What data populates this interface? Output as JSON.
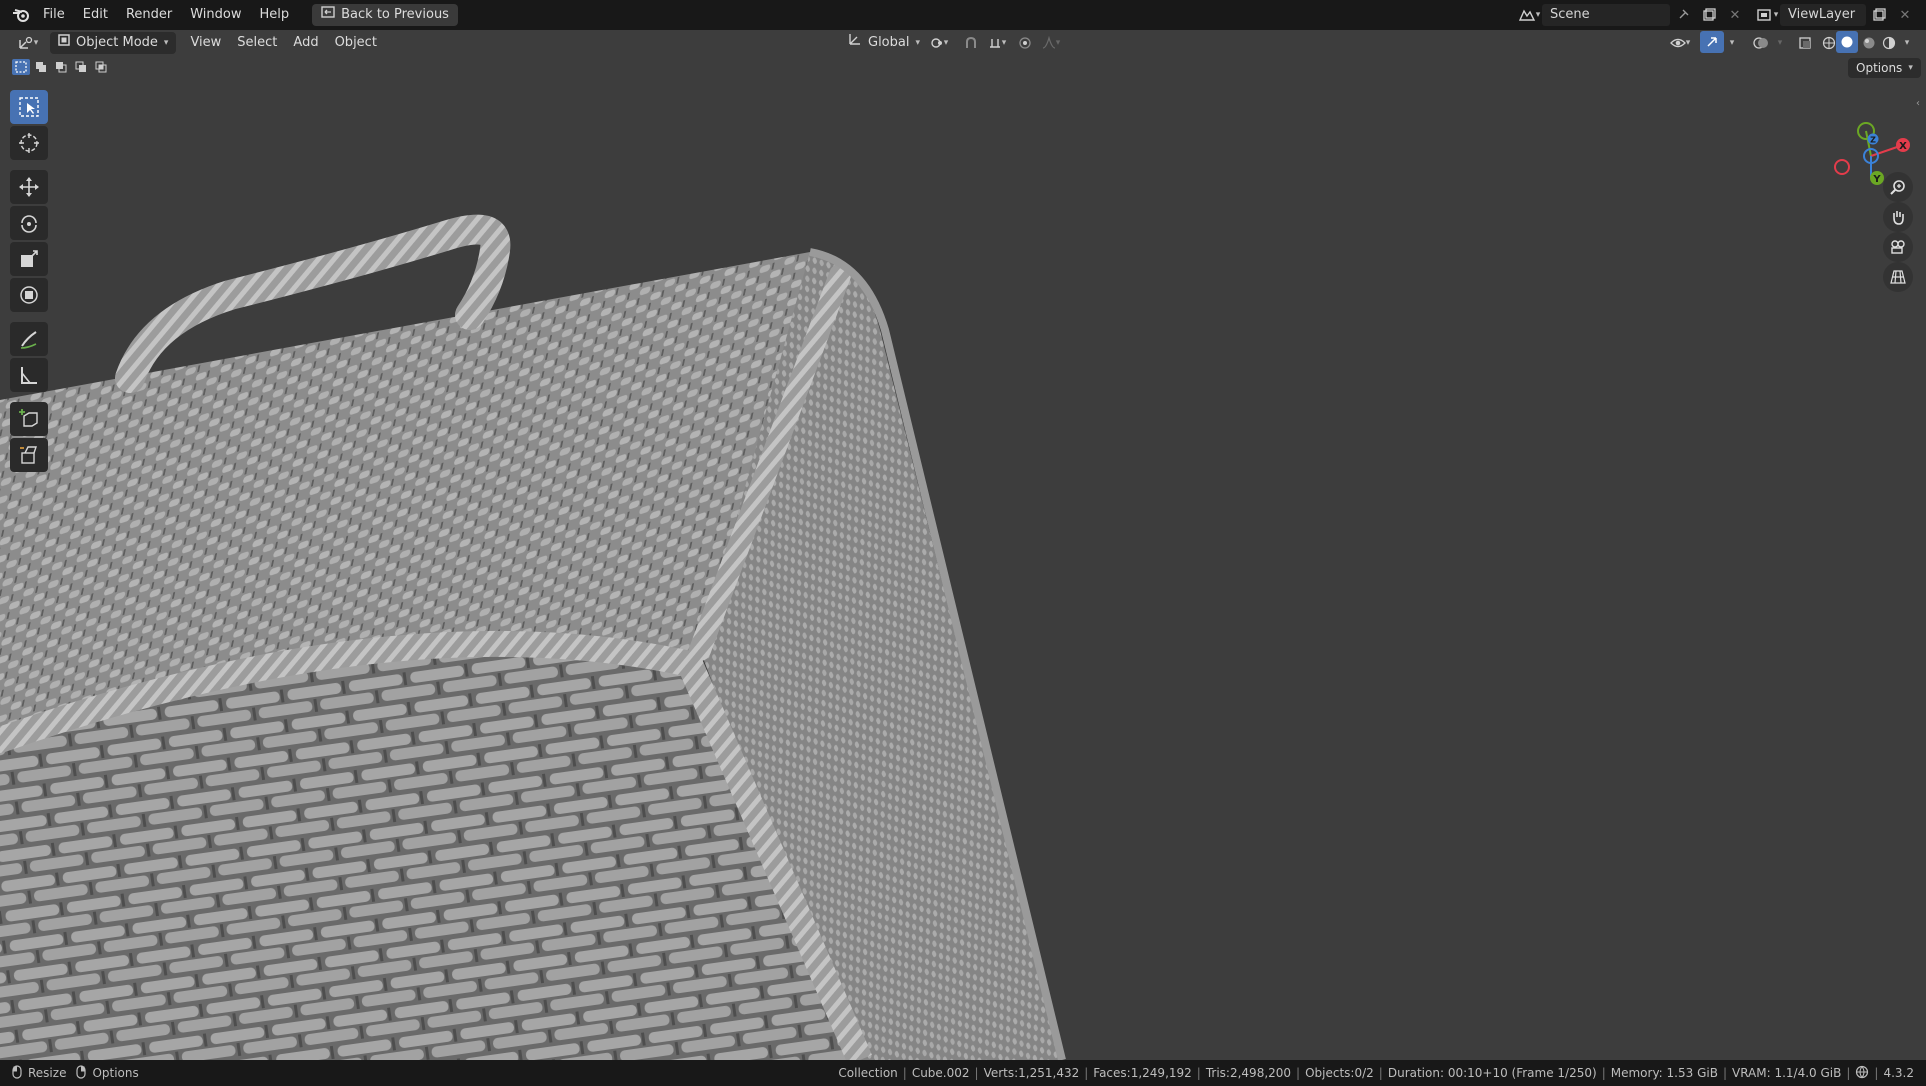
{
  "menu": {
    "file": "File",
    "edit": "Edit",
    "render": "Render",
    "window": "Window",
    "help": "Help",
    "back_label": "Back to Previous"
  },
  "scene": {
    "scene_name": "Scene",
    "view_layer": "ViewLayer"
  },
  "header": {
    "mode": "Object Mode",
    "view": "View",
    "select": "Select",
    "add": "Add",
    "object": "Object",
    "orientation": "Global",
    "options": "Options"
  },
  "gizmo": {
    "x": "X",
    "y": "Y",
    "z": "Z"
  },
  "status": {
    "left_resize": "Resize",
    "left_options": "Options",
    "collection": "Collection",
    "object": "Cube.002",
    "verts": "Verts:1,251,432",
    "faces": "Faces:1,249,192",
    "tris": "Tris:2,498,200",
    "objects": "Objects:0/2",
    "duration": "Duration: 00:10+10 (Frame 1/250)",
    "memory": "Memory: 1.53 GiB",
    "vram": "VRAM: 1.1/4.0 GiB",
    "version": "4.3.2"
  },
  "colors": {
    "accent": "#4772b3",
    "viewport_bg": "#3d3d3d",
    "axis_x": "#e33c4b",
    "axis_y": "#6ba724",
    "axis_z": "#3b82d8"
  }
}
